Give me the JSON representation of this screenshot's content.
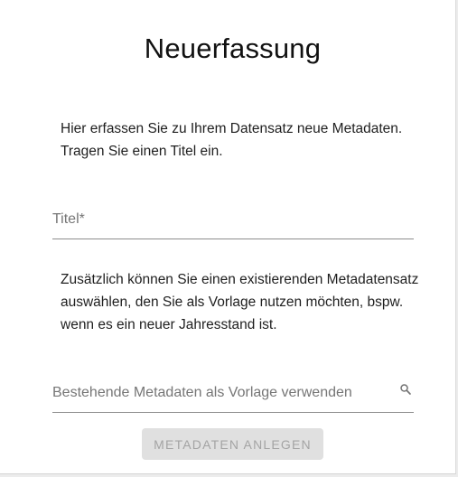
{
  "dialog": {
    "title": "Neuerfassung",
    "intro_text": "Hier erfassen Sie zu Ihrem Datensatz neue Metadaten. Tragen Sie einen Titel ein.",
    "title_field": {
      "placeholder": "Titel*",
      "value": ""
    },
    "template_text": "Zusätzlich können Sie einen existierenden Metadatensatz auswählen, den Sie als Vorlage nutzen möchten, bspw. wenn es ein neuer Jahresstand ist.",
    "template_search": {
      "placeholder": "Bestehende Metadaten als Vorlage verwenden",
      "value": "",
      "icon": "search-icon"
    },
    "create_button": {
      "label": "METADATEN ANLEGEN",
      "state": "disabled"
    }
  }
}
